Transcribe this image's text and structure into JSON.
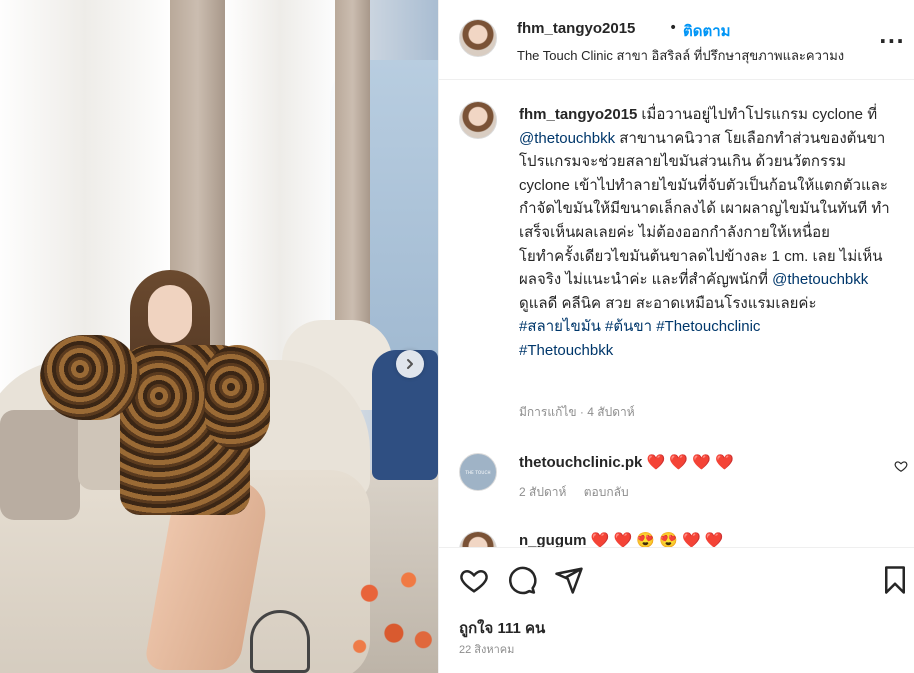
{
  "post": {
    "username": "fhm_tangyo2015",
    "follow_label": "ติดตาม",
    "separator": "•",
    "location": "The Touch Clinic สาขา อิสริลล์ ที่ปรึกษาสุขภาพและความง",
    "more_label": "..."
  },
  "caption": {
    "username": "fhm_tangyo2015",
    "part1": "เมื่อวานอยู่ไปทำโปรแกรม cyclone ที่ ",
    "mention1": "@thetouchbkk",
    "part2": " สาขานาคนิวาส โยเลือกทำส่วนของต้นขา โปรแกรมจะช่วยสลายไขมันส่วนเกิน ด้วยนวัตกรรม cyclone เข้าไปทำลายไขมันที่จับตัวเป็นก้อนให้แตกตัวและกำจัดไขมันให้มีขนาดเล็กลงได้ เผาผลาญไขมันในทันที ทำเสร็จเห็นผลเลยค่ะ ไม่ต้องออกกำลังกายให้เหนื่อย",
    "part3": "โยทำครั้งเดียวไขมันต้นขาลดไปข้างละ 1 cm. เลย ไม่เห็นผลจริง ไม่แนะนำค่ะ และที่สำคัญพนักที่ ",
    "mention2": "@thetouchbkk",
    "part4": " ดูแลดี คลีนิค สวย สะอาดเหมือนโรงแรมเลยค่ะ",
    "tags_line1": "#สลายไขมัน #ต้นขา #Thetouchclinic",
    "tags_line2": "#Thetouchbkk",
    "meta": "มีการแก้ไข · 4 สัปดาห์"
  },
  "comments": [
    {
      "username": "thetouchclinic.pk",
      "avatar_text": "THE TOUCH",
      "text": "❤️ ❤️ ❤️ ❤️",
      "time": "2 สัปดาห์",
      "reply_label": "ตอบกลับ"
    },
    {
      "username": "n_gugum",
      "text": "❤️ ❤️ 😍 😍 ❤️ ❤️"
    }
  ],
  "actions": {
    "likes": "ถูกใจ 111 คน",
    "date": "22 สิงหาคม"
  },
  "icons": {
    "heart": "heart-icon",
    "comment": "comment-icon",
    "share": "share-icon",
    "save": "bookmark-icon",
    "next": "chevron-right-icon"
  },
  "colors": {
    "link": "#00376b",
    "follow": "#0095f6",
    "muted": "#8e8e8e"
  }
}
